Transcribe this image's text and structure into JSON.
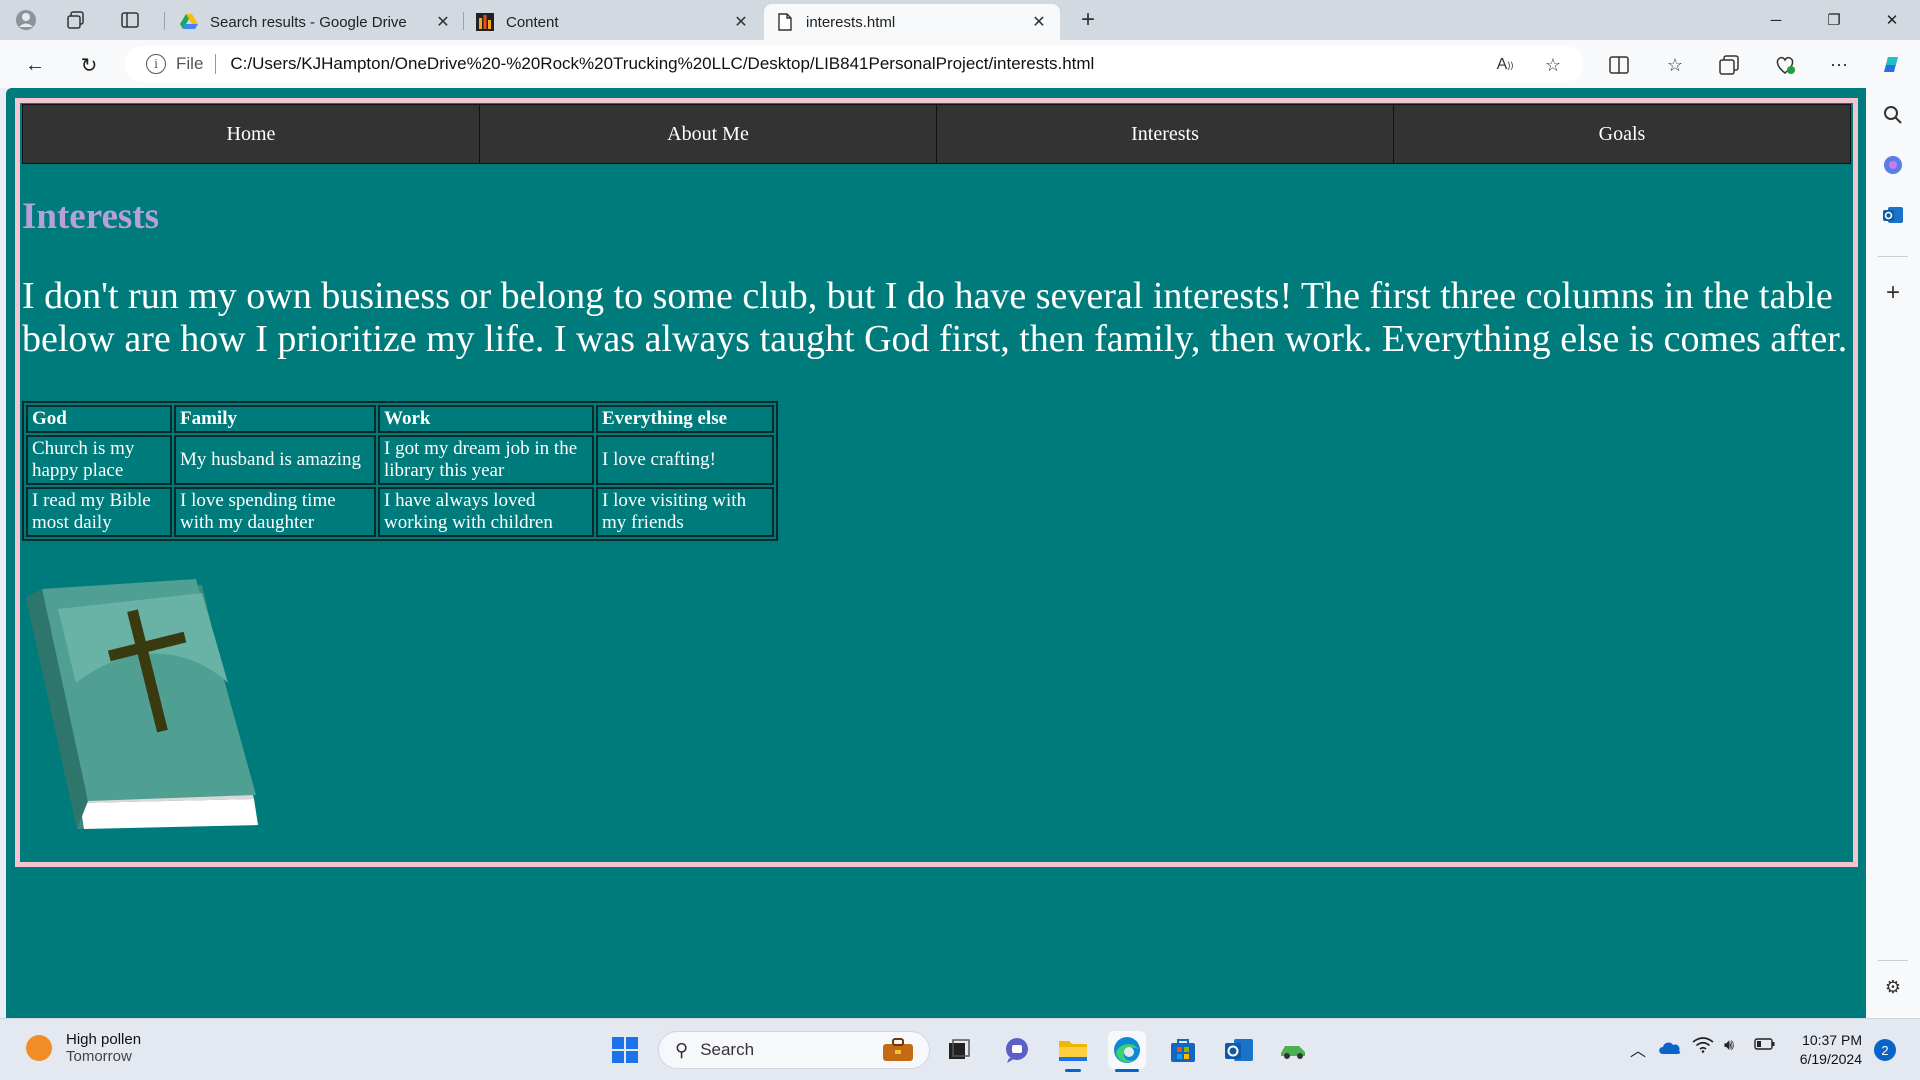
{
  "browser": {
    "tabs": [
      {
        "title": "Search results - Google Drive",
        "icon": "google-drive-icon"
      },
      {
        "title": "Content",
        "icon": "content-icon"
      },
      {
        "title": "interests.html",
        "icon": "file-icon"
      }
    ],
    "url_scheme": "File",
    "url": "C:/Users/KJHampton/OneDrive%20-%20Rock%20Trucking%20LLC/Desktop/LIB841PersonalProject/interests.html"
  },
  "page": {
    "nav": [
      "Home",
      "About Me",
      "Interests",
      "Goals"
    ],
    "title": "Interests",
    "intro": "I don't run my own business or belong to some club, but I do have several interests! The first three columns in the table below are how I prioritize my life. I was always taught God first, then family, then work. Everything else is comes after.",
    "table": {
      "headers": [
        "God",
        "Family",
        "Work",
        "Everything else"
      ],
      "rows": [
        [
          "Church is my happy place",
          "My husband is amazing",
          "I got my dream job in the library this year",
          "I love crafting!"
        ],
        [
          "I read my Bible most daily",
          "I love spending time with my daughter",
          "I have always loved working with children",
          "I love visiting with my friends"
        ]
      ]
    },
    "image": "bible-icon",
    "colors": {
      "background": "#007b7b",
      "frame": "#f4c4d0",
      "title": "#b7a0d8",
      "nav": "#333333"
    }
  },
  "taskbar": {
    "weather_line1": "High pollen",
    "weather_line2": "Tomorrow",
    "search_placeholder": "Search",
    "time": "10:37 PM",
    "date": "6/19/2024",
    "notification_count": "2"
  }
}
